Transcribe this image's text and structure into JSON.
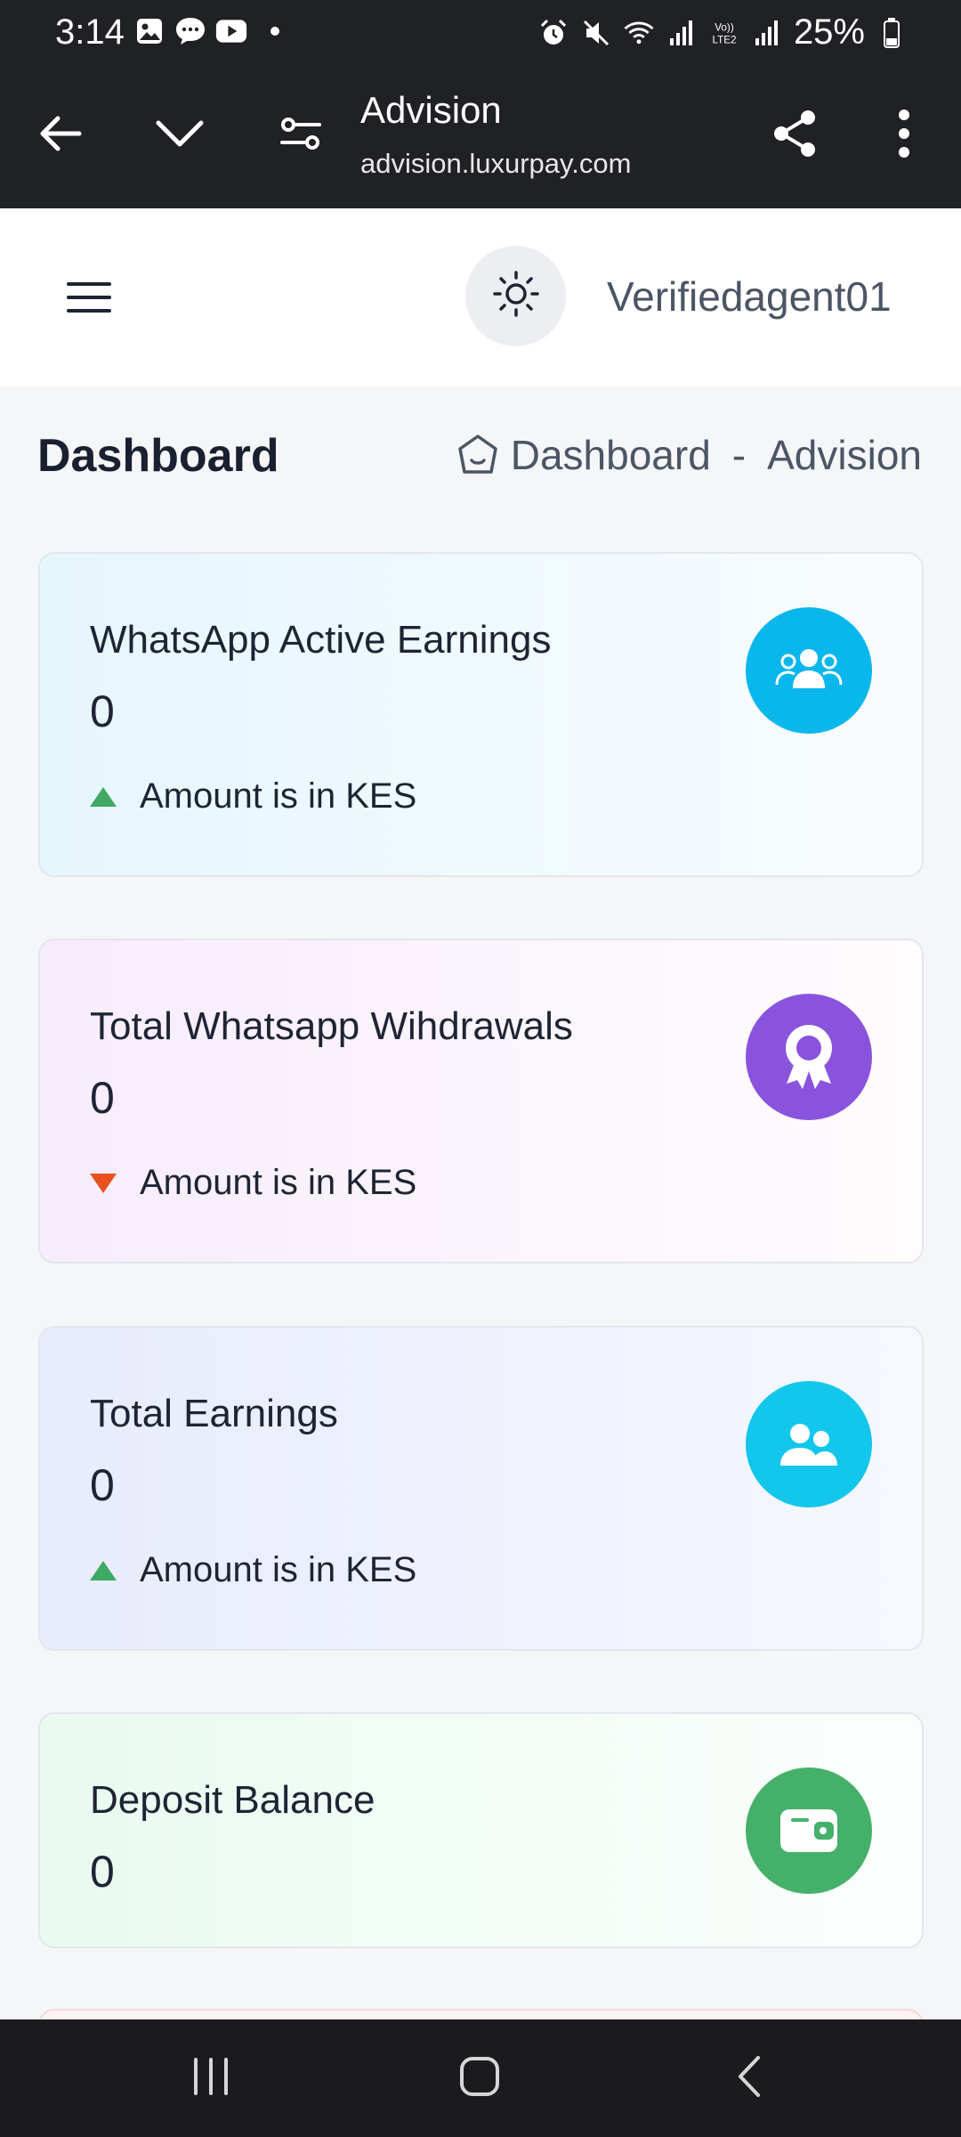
{
  "status_bar": {
    "time": "3:14",
    "battery": "25%",
    "left_icons": [
      "gallery-icon",
      "message-icon",
      "youtube-icon"
    ],
    "right_icons": [
      "alarm-icon",
      "mute-icon",
      "wifi-icon",
      "signal-icon",
      "volte-icon",
      "signal-icon",
      "battery-icon"
    ]
  },
  "browser": {
    "title": "Advision",
    "url": "advision.luxurpay.com"
  },
  "header": {
    "username": "Verifiedagent01"
  },
  "page": {
    "title": "Dashboard",
    "breadcrumb": {
      "current": "Dashboard",
      "separator": "-",
      "site": "Advision"
    }
  },
  "cards": [
    {
      "title": "WhatsApp Active Earnings",
      "value": "0",
      "note": "Amount is in KES",
      "trend": "up",
      "icon": "users-icon",
      "icon_color": "#0ab7ec"
    },
    {
      "title": "Total Whatsapp Wihdrawals",
      "value": "0",
      "note": "Amount is in KES",
      "trend": "down",
      "icon": "award-icon",
      "icon_color": "#8a53de"
    },
    {
      "title": "Total Earnings",
      "value": "0",
      "note": "Amount is in KES",
      "trend": "up",
      "icon": "user-group-icon",
      "icon_color": "#12c6ec"
    },
    {
      "title": "Deposit Balance",
      "value": "0",
      "icon": "wallet-icon",
      "icon_color": "#45b06a"
    }
  ],
  "colors": {
    "topbar": "#202124",
    "trend_up": "#3fa865",
    "trend_down": "#e8501e"
  }
}
